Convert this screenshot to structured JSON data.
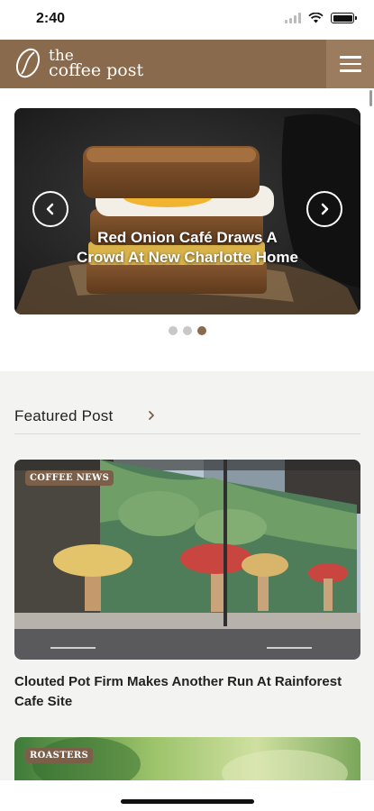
{
  "status_bar": {
    "time": "2:40"
  },
  "header": {
    "logo_line1": "the",
    "logo_line2": "coffee post"
  },
  "carousel": {
    "slide_title": "Red Onion Café Draws A Crowd At New Charlotte Home",
    "dot_count": 3,
    "active_dot": 3
  },
  "featured": {
    "section_title": "Featured Post",
    "posts": [
      {
        "tag": "COFFEE NEWS",
        "title": "Clouted Pot Firm Makes Another Run At Rainforest Cafe Site"
      },
      {
        "tag": "ROASTERS",
        "title": ""
      }
    ]
  },
  "colors": {
    "brand": "#8a6a4c",
    "tag": "#7c5f49",
    "section_bg": "#f3f3f1"
  }
}
